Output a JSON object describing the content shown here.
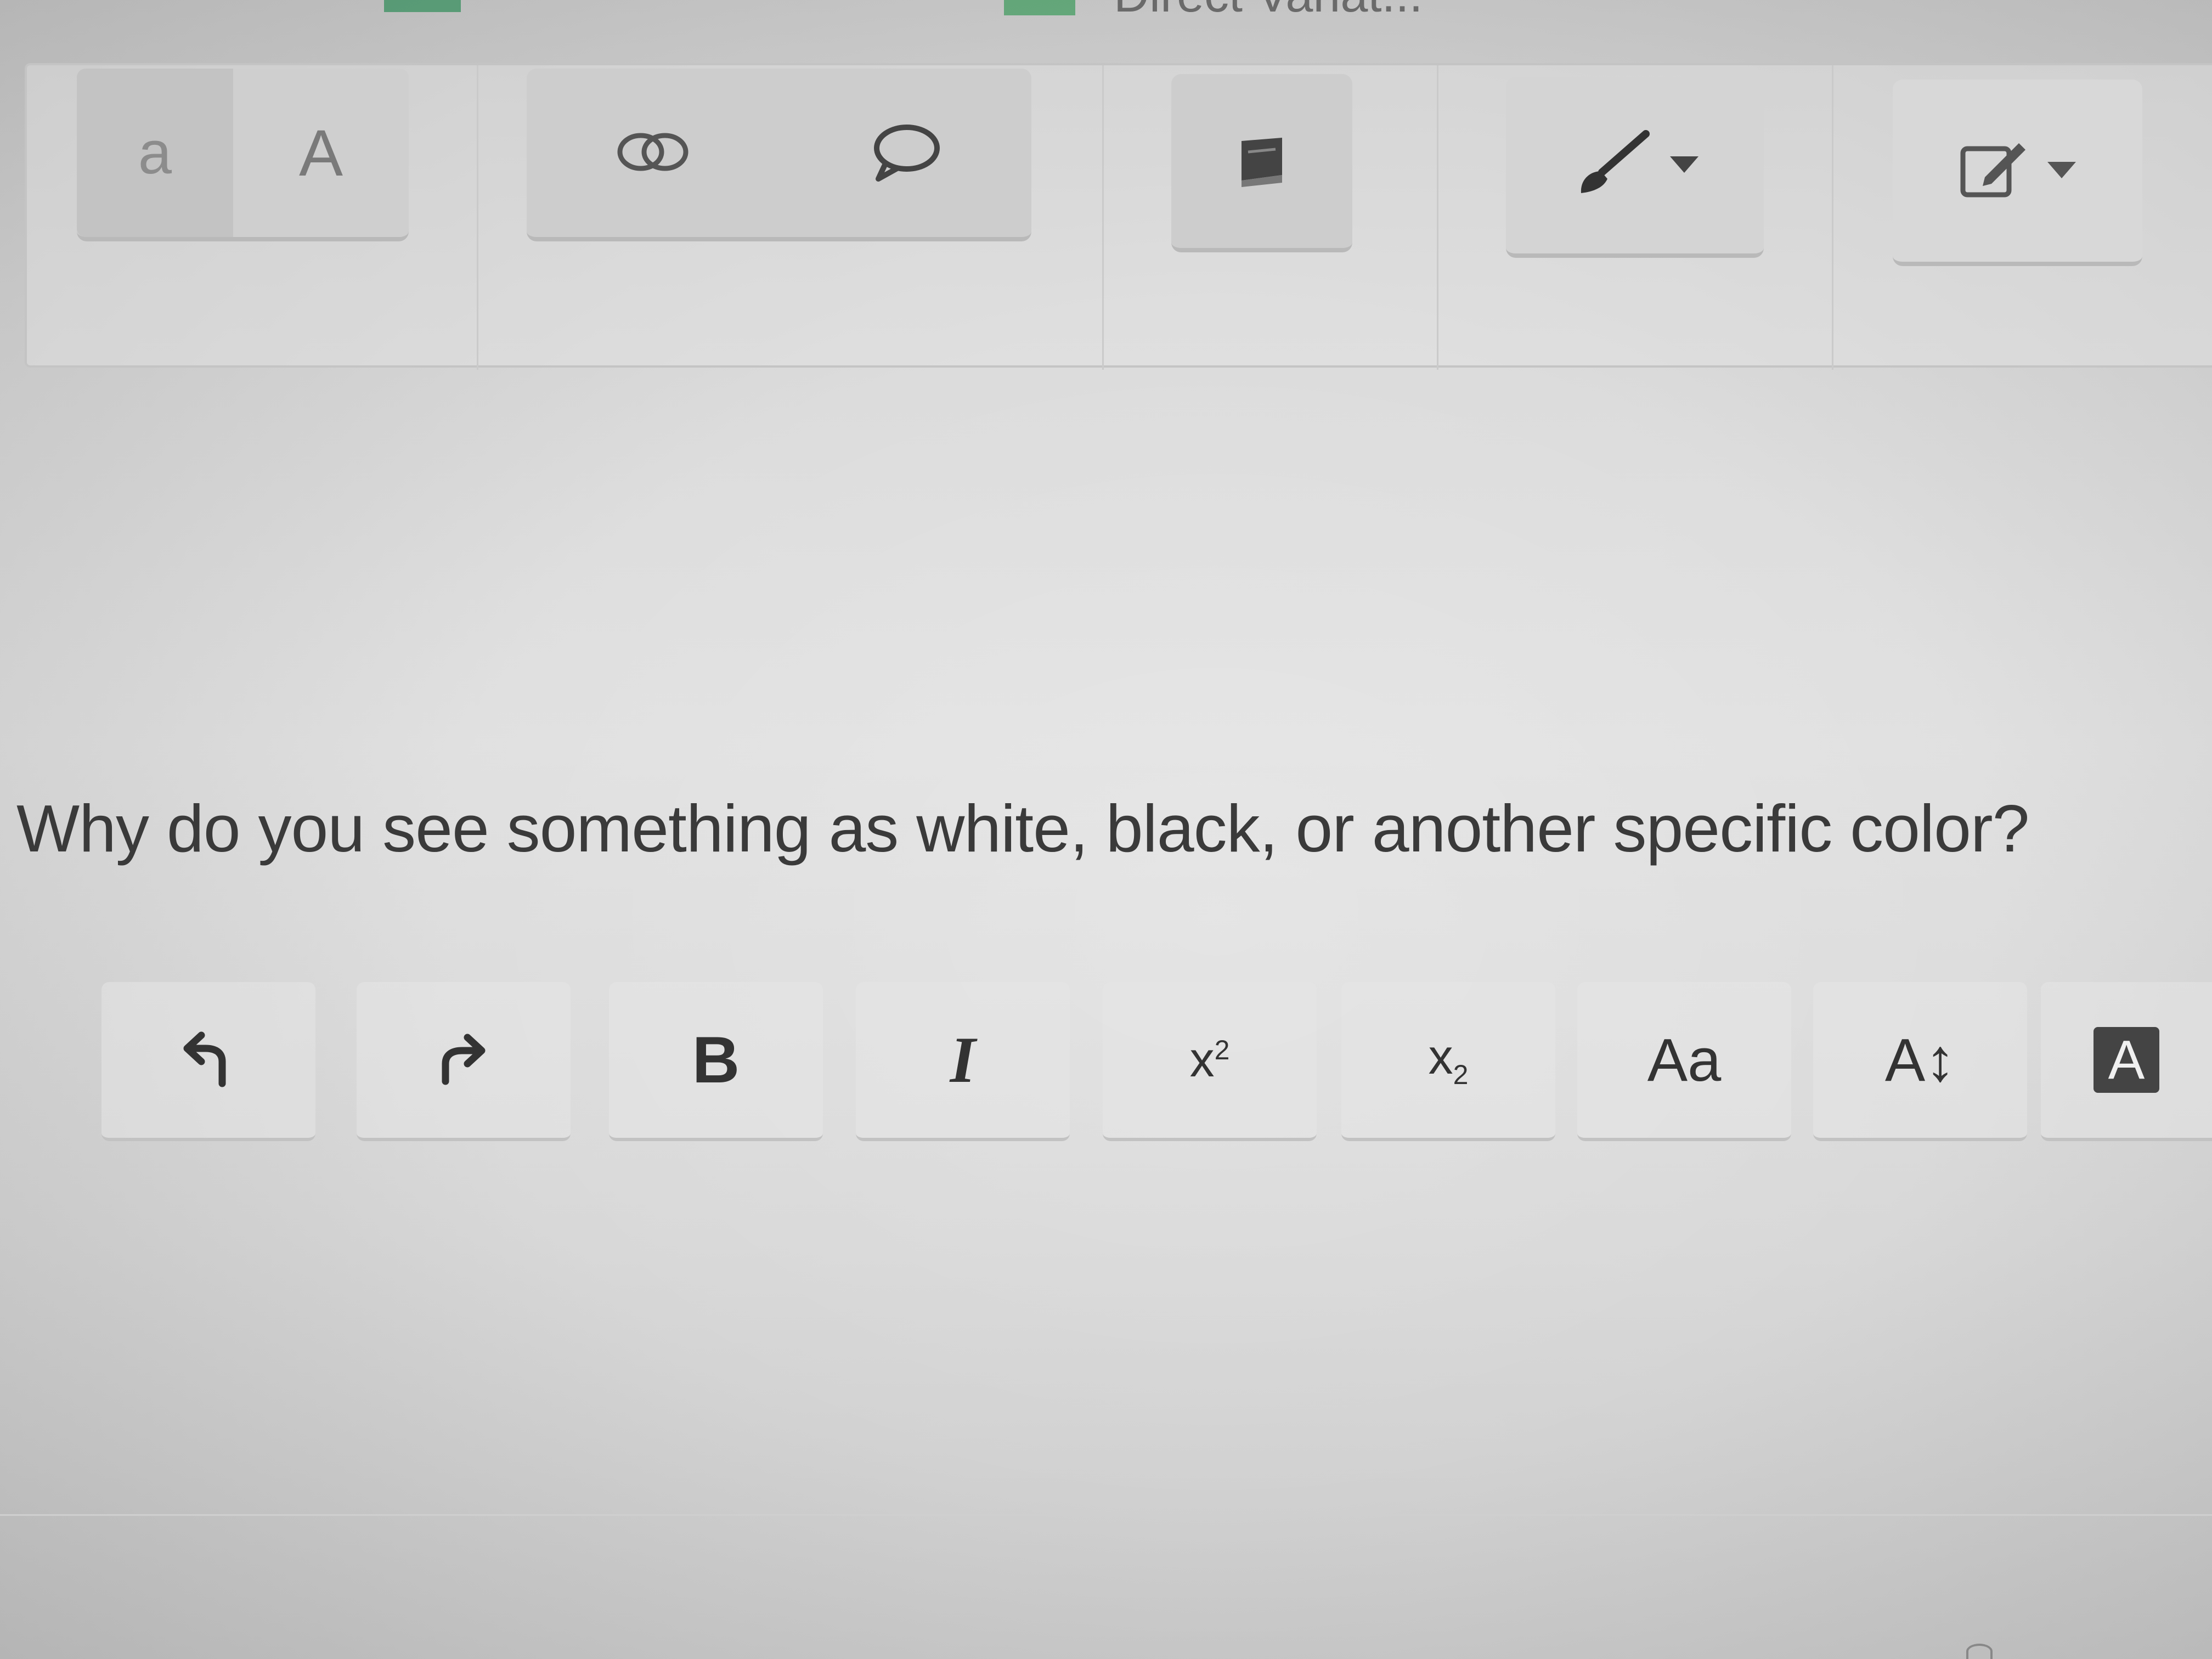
{
  "top_strip": {
    "cut_title": "Direct Variat..."
  },
  "toolbar_top": {
    "case_lower_label": "a",
    "case_upper_label": "A",
    "icons": {
      "link": "link-icon",
      "comment": "comment-icon",
      "book": "book-icon",
      "brush": "brush-icon",
      "edit": "edit-icon",
      "dropdown": "caret-down-icon"
    }
  },
  "question": {
    "text": "Why do you see something as white, black, or another specific color?"
  },
  "format_toolbar": {
    "undo_icon": "undo-icon",
    "redo_icon": "redo-icon",
    "bold_label": "B",
    "italic_label": "I",
    "superscript_base": "x",
    "superscript_exp": "2",
    "subscript_base": "x",
    "subscript_idx": "2",
    "case_label": "Aa",
    "size_label": "A",
    "size_arrow": "↕",
    "highlight_label": "A"
  },
  "colors": {
    "background": "#d9d9d9",
    "text": "#3a3a3a",
    "button_bg": "#cdcdcd",
    "accent_green": "#2e8b57"
  }
}
